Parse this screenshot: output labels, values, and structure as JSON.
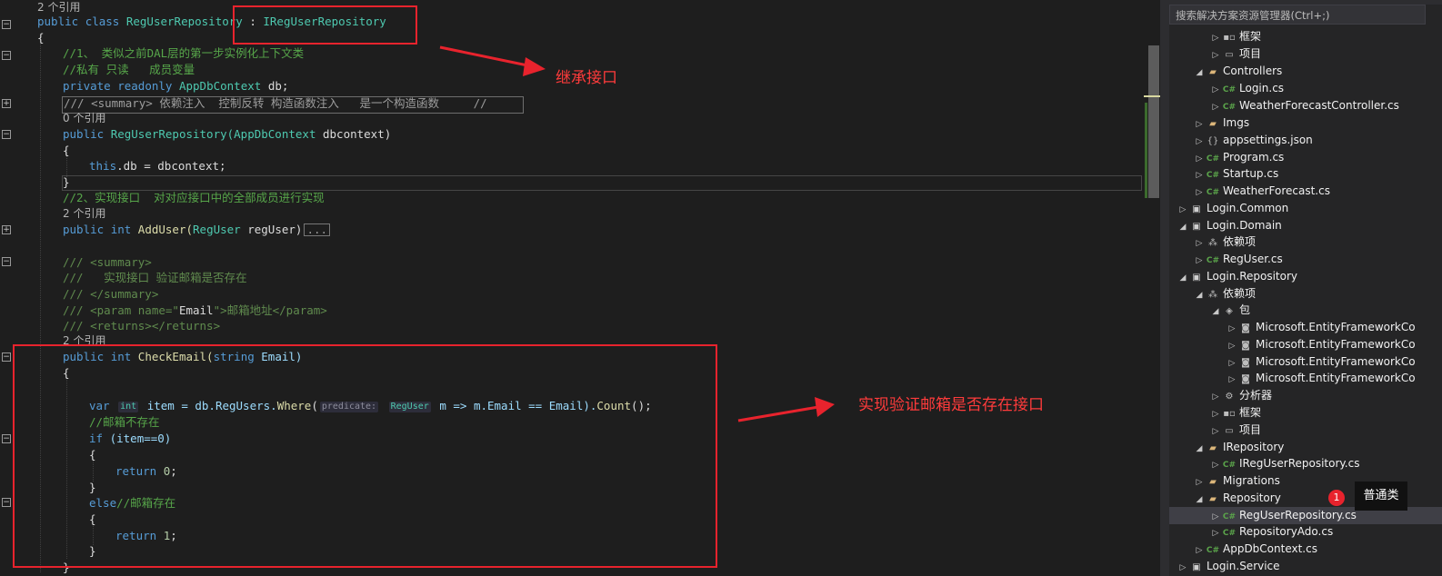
{
  "editor": {
    "ref_2": "2 个引用",
    "ref_0": "0 个引用",
    "class_decl": {
      "kw1": "public",
      "kw2": "class",
      "name": "RegUserRepository",
      "sep": " : ",
      "iface": "IRegUserRepository"
    },
    "brace_open": "{",
    "brace_close": "}",
    "comment_1": "//1、 类似之前DAL层的第一步实例化上下文类",
    "comment_2": "//私有 只读   成员变量",
    "field_decl": {
      "kw1": "private",
      "kw2": "readonly",
      "type": "AppDbContext",
      "name": "db;"
    },
    "summary_line": "/// <summary> 依赖注入  控制反转 构造函数注入   是一个构造函数     //",
    "ctor_decl": {
      "kw": "public",
      "name": "RegUserRepository(",
      "type": "AppDbContext",
      "param": "dbcontext)"
    },
    "ctor_body": {
      "kw": "this",
      "rest": ".db = dbcontext;"
    },
    "comment_3": "//2、实现接口  对对应接口中的全部成员进行实现",
    "adduser_decl": {
      "kw1": "public",
      "kw2": "int",
      "name": "AddUser(",
      "type": "RegUser",
      "param": "regUser)",
      "collapsed": "..."
    },
    "doc_1": "/// <summary>",
    "doc_2": "///   实现接口 验证邮箱是否存在",
    "doc_3": "/// </summary>",
    "doc_4_a": "/// <param name=\"",
    "doc_4_b": "Email",
    "doc_4_c": "\">邮箱地址</param>",
    "doc_5": "/// <returns></returns>",
    "checkemail_decl": {
      "kw1": "public",
      "kw2": "int",
      "name": "CheckEmail(",
      "kw3": "string",
      "param": "Email)"
    },
    "var_line": {
      "kw": "var",
      "hint_type": "int",
      "name": "item = db.RegUsers.",
      "fn": "Where",
      "open": "(",
      "hint_label": "predicate:",
      "hint_arg": "RegUser",
      "lambda": "m => m.Email == Email).",
      "fn2": "Count",
      "end": "();"
    },
    "comment_4": "//邮箱不存在",
    "if_line": {
      "kw": "if",
      "cond": " (item==0)"
    },
    "return_0": {
      "kw": "return",
      "val": "0",
      "end": ";"
    },
    "else_line": {
      "kw": "else",
      "comment": "//邮箱存在"
    },
    "return_1": {
      "kw": "return",
      "val": "1",
      "end": ";"
    }
  },
  "explorer": {
    "search_placeholder": "搜索解决方案资源管理器(Ctrl+;)",
    "items": [
      {
        "label": "框架",
        "icon": "framework-icon"
      },
      {
        "label": "项目",
        "icon": "project-ref-icon"
      },
      {
        "label": "Controllers",
        "icon": "folder-icon"
      },
      {
        "label": "Login.cs",
        "icon": "csharp-file-icon"
      },
      {
        "label": "WeatherForecastController.cs",
        "icon": "csharp-file-icon"
      },
      {
        "label": "Imgs",
        "icon": "folder-icon"
      },
      {
        "label": "appsettings.json",
        "icon": "json-file-icon"
      },
      {
        "label": "Program.cs",
        "icon": "csharp-file-icon"
      },
      {
        "label": "Startup.cs",
        "icon": "csharp-file-icon"
      },
      {
        "label": "WeatherForecast.cs",
        "icon": "csharp-file-icon"
      },
      {
        "label": "Login.Common",
        "icon": "csharp-project-icon"
      },
      {
        "label": "Login.Domain",
        "icon": "csharp-project-icon"
      },
      {
        "label": "依赖项",
        "icon": "dependencies-icon"
      },
      {
        "label": "RegUser.cs",
        "icon": "csharp-file-icon"
      },
      {
        "label": "Login.Repository",
        "icon": "csharp-project-icon"
      },
      {
        "label": "依赖项",
        "icon": "dependencies-icon"
      },
      {
        "label": "包",
        "icon": "package-icon"
      },
      {
        "label": "Microsoft.EntityFrameworkCo",
        "icon": "nuget-icon"
      },
      {
        "label": "Microsoft.EntityFrameworkCo",
        "icon": "nuget-icon"
      },
      {
        "label": "Microsoft.EntityFrameworkCo",
        "icon": "nuget-icon"
      },
      {
        "label": "Microsoft.EntityFrameworkCo",
        "icon": "nuget-icon"
      },
      {
        "label": "分析器",
        "icon": "analyzer-icon"
      },
      {
        "label": "框架",
        "icon": "framework-icon"
      },
      {
        "label": "项目",
        "icon": "project-ref-icon"
      },
      {
        "label": "IRepository",
        "icon": "folder-icon"
      },
      {
        "label": "IRegUserRepository.cs",
        "icon": "csharp-file-icon"
      },
      {
        "label": "Migrations",
        "icon": "folder-icon"
      },
      {
        "label": "Repository",
        "icon": "folder-icon"
      },
      {
        "label": "RegUserRepository.cs",
        "icon": "csharp-file-icon"
      },
      {
        "label": "RepositoryAdo.cs",
        "icon": "csharp-file-icon"
      },
      {
        "label": "AppDbContext.cs",
        "icon": "csharp-file-icon"
      },
      {
        "label": "Login.Service",
        "icon": "csharp-project-icon"
      }
    ],
    "tooltip": "普通类",
    "badge": "1"
  },
  "annotations": {
    "inherit": "继承接口",
    "implement": "实现验证邮箱是否存在接口"
  },
  "colors": {
    "annotation": "#e8232d",
    "keyword": "#569cd6",
    "type": "#4ec9b0",
    "comment": "#57a64a"
  }
}
